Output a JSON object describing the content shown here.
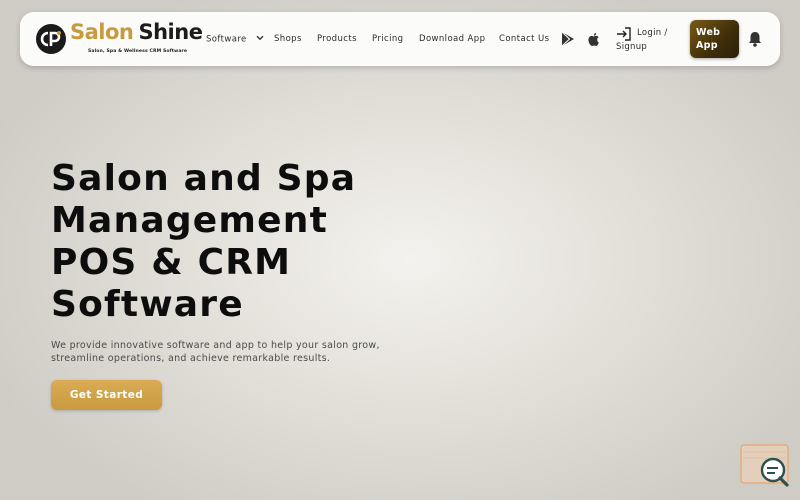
{
  "brand": {
    "name_part1": "Salon",
    "name_part2": "Shine",
    "tagline": "Salon, Spa & Wellness CRM Software",
    "colors": {
      "gold": "#c79a3d",
      "dark": "#1c1c1c"
    }
  },
  "nav": {
    "items": [
      {
        "label": "Software",
        "has_dropdown": true
      },
      {
        "label": "Shops"
      },
      {
        "label": "Products"
      },
      {
        "label": "Pricing"
      },
      {
        "label": "Download App"
      },
      {
        "label": "Contact Us"
      }
    ],
    "store_icons": [
      "google-play-icon",
      "apple-icon"
    ],
    "login_line1": "Login /",
    "login_line2": "Signup",
    "web_app_line1": "Web",
    "web_app_line2": "App",
    "bell_icon": "bell-icon"
  },
  "hero": {
    "title_lines": [
      "Salon and Spa",
      "Management",
      "POS & CRM",
      "Software"
    ],
    "subtitle_line1": "We provide innovative software and app to help your salon grow,",
    "subtitle_line2": "streamline operations, and achieve remarkable results.",
    "cta_label": "Get Started",
    "cta_color": "#d3a54b"
  },
  "widgets": {
    "chat_icon": "chat-search-icon"
  }
}
